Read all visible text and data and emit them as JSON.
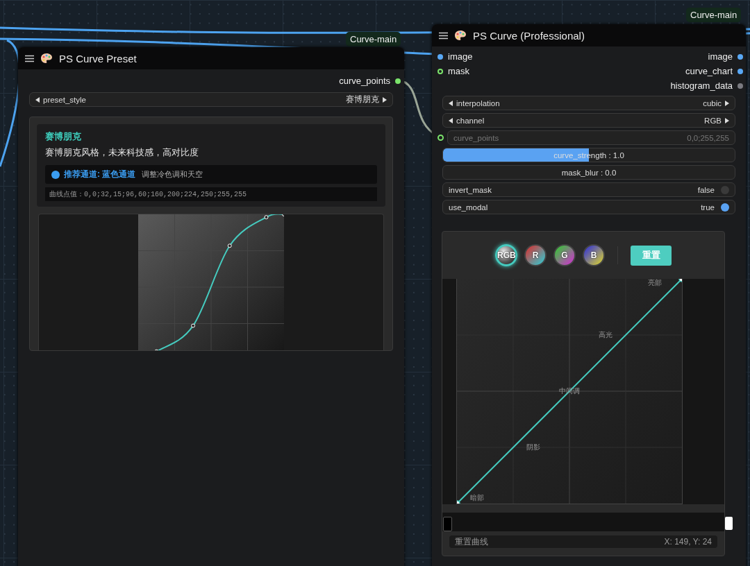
{
  "group_labels": [
    "Curve-main",
    "Curve-main"
  ],
  "preset_node": {
    "title": "PS Curve Preset",
    "outputs": [
      {
        "label": "curve_points",
        "connected": true,
        "color": "#7be36b"
      }
    ],
    "preset_style": {
      "label": "preset_style",
      "value": "赛博朋克"
    },
    "card": {
      "title": "赛博朋克",
      "description": "赛博朋克风格，未来科技感，高对比度",
      "channel": {
        "label": "推荐通道: 蓝色通道",
        "note": "调整冷色调和天空",
        "color": "#3a9cf0"
      },
      "points_text": "曲线点值：0,0;32,15;96,60;160,200;224,250;255,255"
    }
  },
  "curve_node": {
    "title": "PS Curve (Professional)",
    "inputs": [
      {
        "label": "image",
        "connected": true,
        "color": "#59a8f5"
      },
      {
        "label": "mask",
        "connected": false,
        "color": "#7be36b"
      }
    ],
    "outputs": [
      {
        "label": "image",
        "connected": true,
        "color": "#59a8f5"
      },
      {
        "label": "curve_chart",
        "connected": true,
        "color": "#59a8f5"
      },
      {
        "label": "histogram_data",
        "connected": true,
        "color": "#7a7a80"
      }
    ],
    "widgets": [
      {
        "kind": "combo",
        "label": "interpolation",
        "value": "cubic"
      },
      {
        "kind": "combo",
        "label": "channel",
        "value": "RGB"
      },
      {
        "kind": "text",
        "label": "curve_points",
        "value": "0,0;255,255"
      },
      {
        "kind": "slider",
        "label": "curve_strength : 1.0",
        "level": 0.5
      },
      {
        "kind": "slider",
        "label": "mask_blur : 0.0",
        "level": 0
      },
      {
        "kind": "toggle",
        "label": "invert_mask",
        "value": "false",
        "on": false
      },
      {
        "kind": "toggle",
        "label": "use_modal",
        "value": "true",
        "on": true
      }
    ],
    "editor": {
      "channels": [
        {
          "label": "RGB",
          "selected": true
        },
        {
          "label": "R",
          "selected": false
        },
        {
          "label": "G",
          "selected": false
        },
        {
          "label": "B",
          "selected": false
        }
      ],
      "reset_button": "重置",
      "zone_labels": [
        "亮部",
        "高光",
        "中间调",
        "阴影",
        "暗部"
      ],
      "reset_link": "重置曲线",
      "coords": "X: 149, Y: 24"
    }
  }
}
